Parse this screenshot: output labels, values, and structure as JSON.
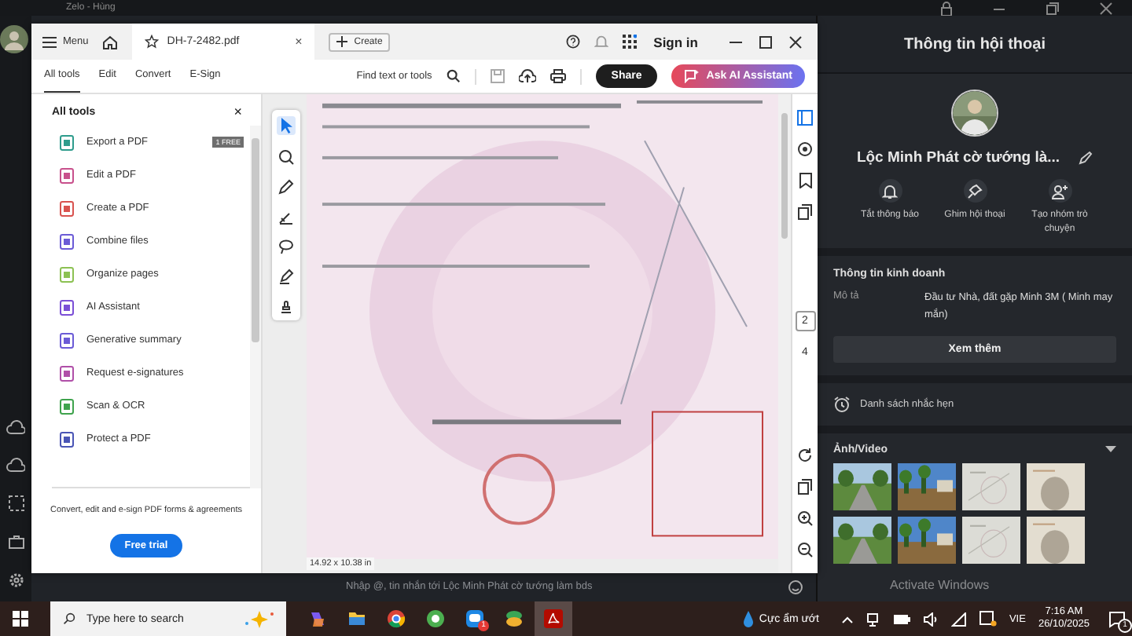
{
  "zalo": {
    "title": "Zelo - Hùng",
    "chat_input": {
      "placeholder": "Nhập @, tin nhắn tới Lộc Minh Phát cờ tướng làm bds"
    }
  },
  "acrobat": {
    "menu": "Menu",
    "tabs": [
      {
        "label": "DH-7-2482.pdf",
        "selected": true
      }
    ],
    "tab_close": "×",
    "create": "Create",
    "sign_in": "Sign in",
    "nav": [
      {
        "label": "All tools",
        "selected": true
      },
      {
        "label": "Edit",
        "selected": false
      },
      {
        "label": "Convert",
        "selected": false
      },
      {
        "label": "E-Sign",
        "selected": false
      }
    ],
    "find": {
      "placeholder": "Find text or tools"
    },
    "share": "Share",
    "ask_ai": "Ask AI Assistant",
    "tools_panel": {
      "title": "All tools",
      "close": "×",
      "items": [
        {
          "label": "Export a PDF",
          "color": "#2e9c8c",
          "badge": "1 FREE"
        },
        {
          "label": "Edit a PDF",
          "color": "#c8508c"
        },
        {
          "label": "Create a PDF",
          "color": "#d9534f"
        },
        {
          "label": "Combine files",
          "color": "#6b5bd6"
        },
        {
          "label": "Organize pages",
          "color": "#8cc152"
        },
        {
          "label": "AI Assistant",
          "color": "#7b4fd6"
        },
        {
          "label": "Generative summary",
          "color": "#6b5bd6"
        },
        {
          "label": "Request e-signatures",
          "color": "#b04fa8"
        },
        {
          "label": "Scan & OCR",
          "color": "#3fa34d"
        },
        {
          "label": "Protect a PDF",
          "color": "#4a55b5"
        }
      ],
      "promo": "Convert, edit and e-sign PDF forms & agreements",
      "cta": "Free trial"
    },
    "page_numbers": [
      {
        "label": "2",
        "selected": true
      },
      {
        "label": "4",
        "selected": false
      }
    ],
    "page_size": "14.92 x 10.38 in"
  },
  "info_panel": {
    "title": "Thông tin hội thoại",
    "name": "Lộc Minh Phát cờ tướng là...",
    "actions": [
      {
        "label": "Tắt thông báo",
        "kind": "bell"
      },
      {
        "label": "Ghim hội thoại",
        "kind": "pin"
      },
      {
        "label": "Tạo nhóm trò chuyện",
        "kind": "group"
      }
    ],
    "business": {
      "title": "Thông tin kinh doanh",
      "key": "Mô tả",
      "value": "Đầu tư Nhà, đất gặp Minh 3M ( Minh may mắn)",
      "more": "Xem thêm"
    },
    "reminders": "Danh sách nhắc hẹn",
    "media": {
      "title": "Ảnh/Video"
    }
  },
  "activation_notice": "Activate Windows",
  "taskbar": {
    "search": {
      "placeholder": "Type here to search"
    },
    "weather": "Cực ẩm ướt",
    "language": "VIE",
    "time": "7:16 AM",
    "date": "26/10/2025",
    "notifications": "1",
    "app_badge": "1"
  }
}
